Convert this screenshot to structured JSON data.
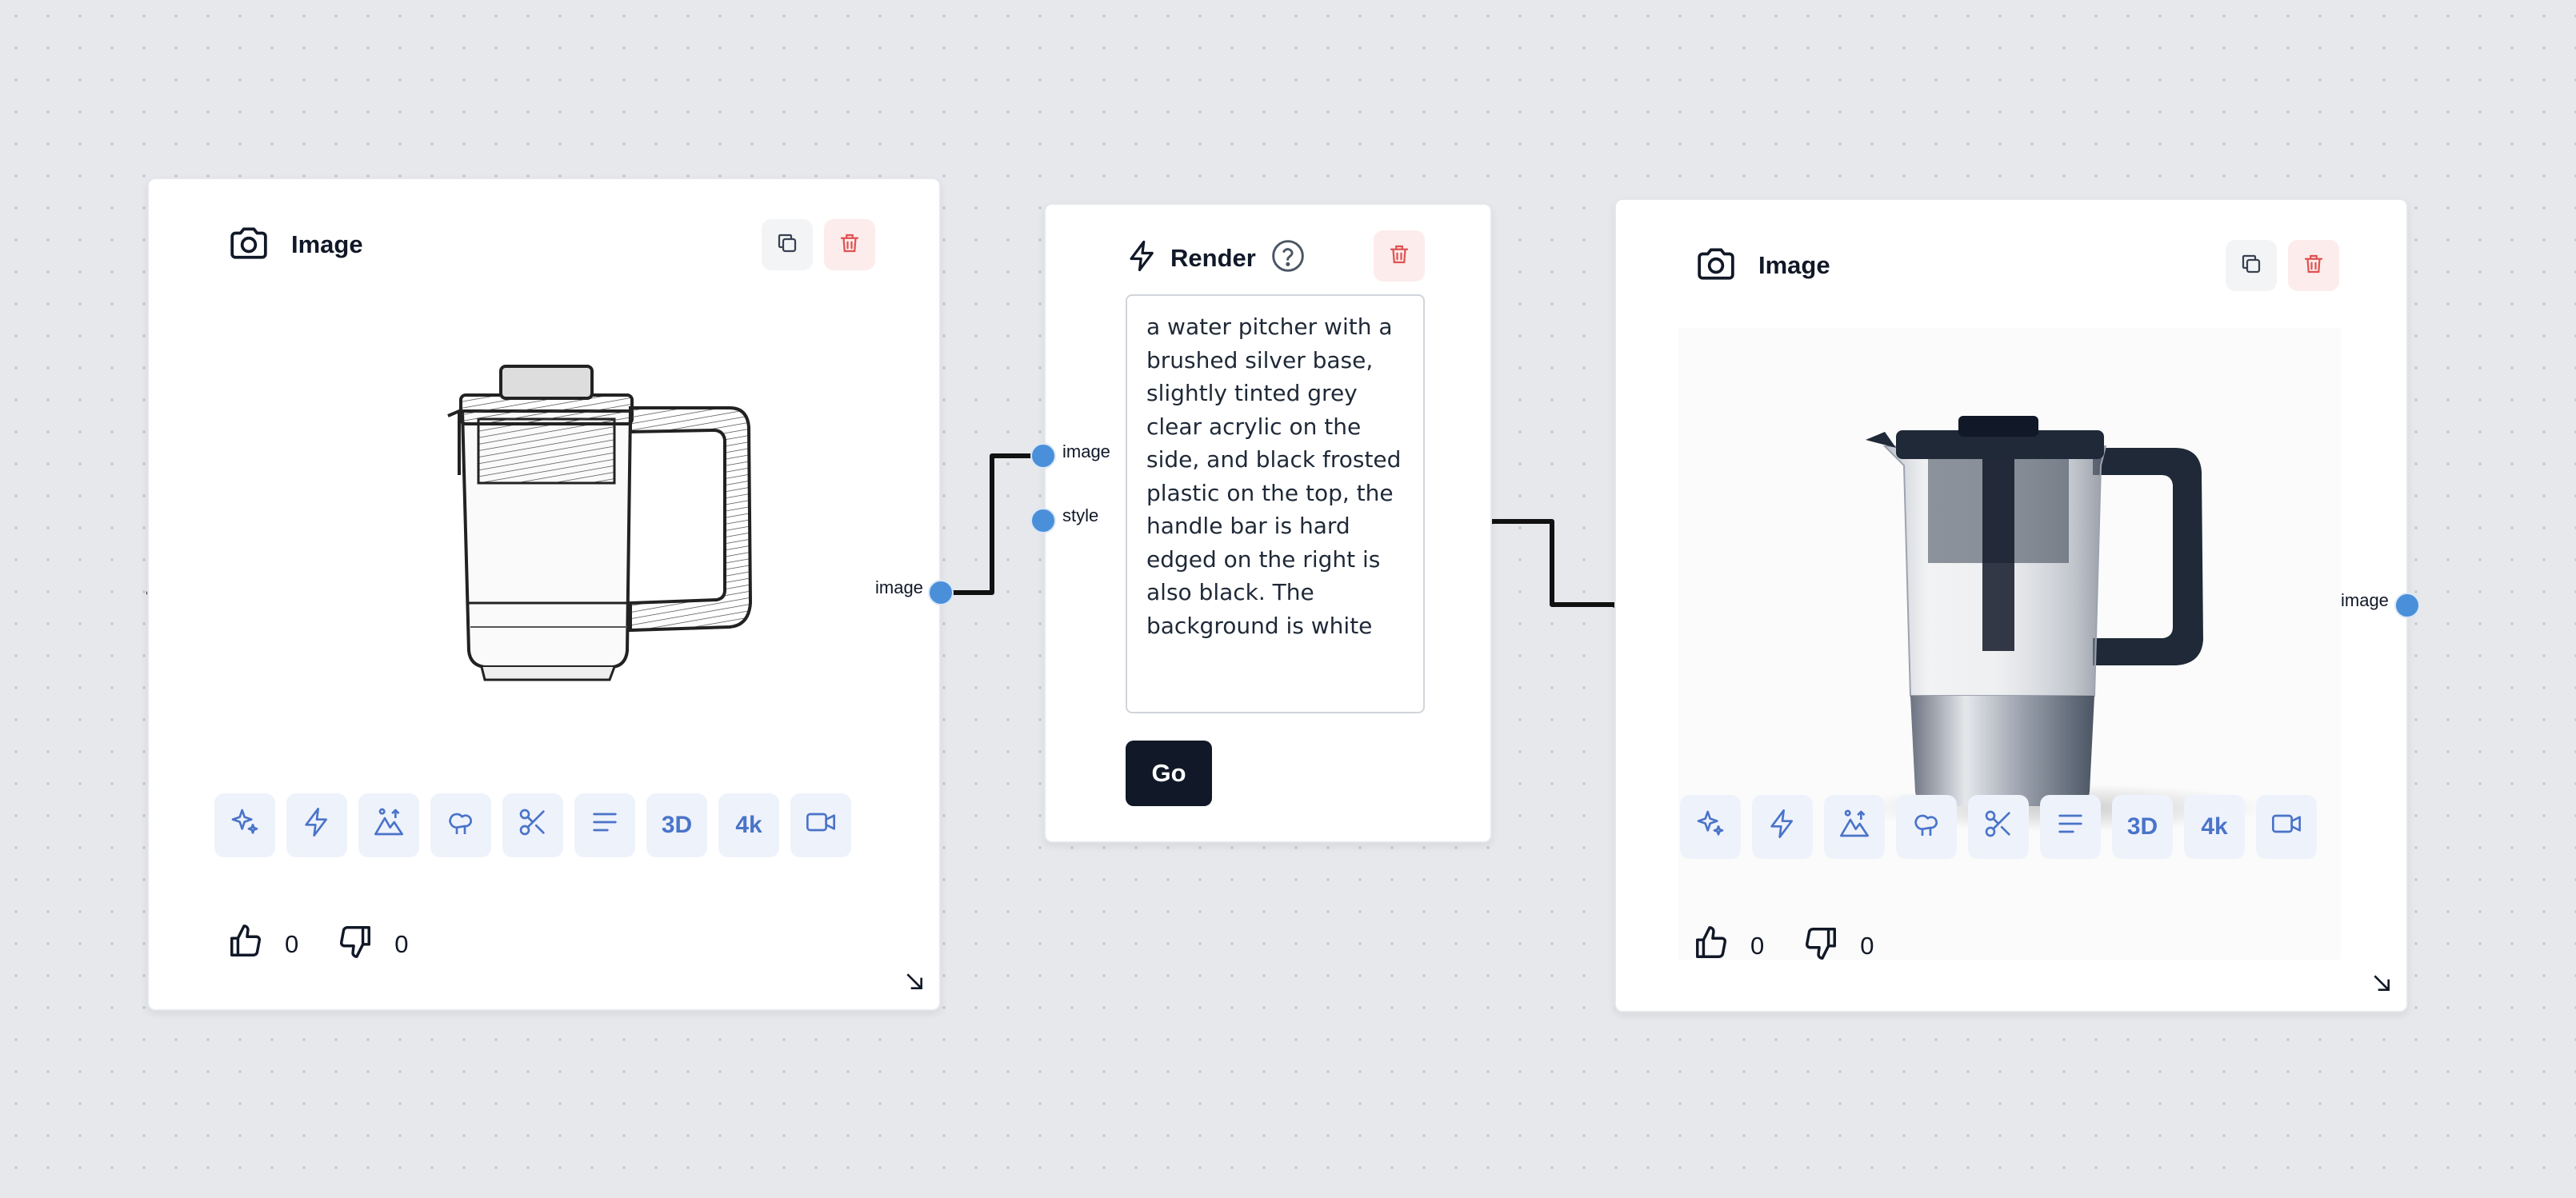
{
  "node_image_1": {
    "title": "Image",
    "header_icon": "camera-icon",
    "copy_icon": "copy-icon",
    "delete_icon": "trash-icon",
    "image_description": "pencil sketch of a water pitcher",
    "tools": [
      {
        "name": "sparkles-icon"
      },
      {
        "name": "lightning-icon"
      },
      {
        "name": "landscape-icon"
      },
      {
        "name": "trees-icon"
      },
      {
        "name": "scissors-icon"
      },
      {
        "name": "align-left-icon"
      },
      {
        "label": "3D"
      },
      {
        "label": "4k"
      },
      {
        "name": "video-icon"
      }
    ],
    "likes": "0",
    "dislikes": "0",
    "output_port_label": "image"
  },
  "node_render": {
    "title": "Render",
    "header_icon": "lightning-icon",
    "help_icon": "help-icon",
    "delete_icon": "trash-icon",
    "prompt_text": "a water pitcher with a brushed silver base, slightly tinted grey clear acrylic on the side, and black frosted plastic on the top, the handle bar is hard edged on the right is also black. The background is white",
    "go_label": "Go",
    "input_ports": [
      "image",
      "style"
    ]
  },
  "node_image_2": {
    "title": "Image",
    "header_icon": "camera-icon",
    "copy_icon": "copy-icon",
    "delete_icon": "trash-icon",
    "image_description": "photorealistic render of a glass water pitcher with black lid and handle",
    "tools": [
      {
        "name": "sparkles-icon"
      },
      {
        "name": "lightning-icon"
      },
      {
        "name": "landscape-icon"
      },
      {
        "name": "trees-icon"
      },
      {
        "name": "scissors-icon"
      },
      {
        "name": "align-left-icon"
      },
      {
        "label": "3D"
      },
      {
        "label": "4k"
      },
      {
        "name": "video-icon"
      }
    ],
    "likes": "0",
    "dislikes": "0",
    "output_port_label": "image"
  },
  "colors": {
    "canvas": "#e6e8ec",
    "port": "#4a8fd9",
    "tool_icon": "#4a74c9",
    "tool_bg": "#eef2fb",
    "delete_red": "#e05252",
    "go_button": "#111827"
  }
}
